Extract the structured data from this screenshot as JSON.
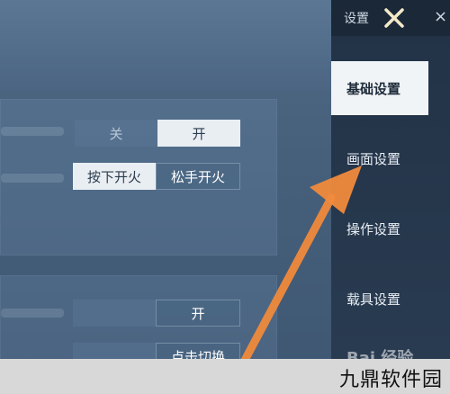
{
  "sidebar": {
    "title": "设置",
    "items": [
      {
        "label": "基础设置",
        "active": true
      },
      {
        "label": "画面设置",
        "active": false
      },
      {
        "label": "操作设置",
        "active": false
      },
      {
        "label": "载具设置",
        "active": false
      }
    ]
  },
  "settings": {
    "row1": {
      "off_label": "关",
      "on_label": "开",
      "selected": "开"
    },
    "row2": {
      "option1": "按下开火",
      "option2": "松手开火",
      "selected": "按下开火"
    },
    "row3": {
      "on_label": "开"
    },
    "row4": {
      "option2": "点击切换"
    }
  },
  "watermark": {
    "text": "九鼎软件园"
  },
  "colors": {
    "arrow": "#f08a3c",
    "active_tab_bg": "#f1f4f7",
    "sidebar_bg": "#223246"
  }
}
